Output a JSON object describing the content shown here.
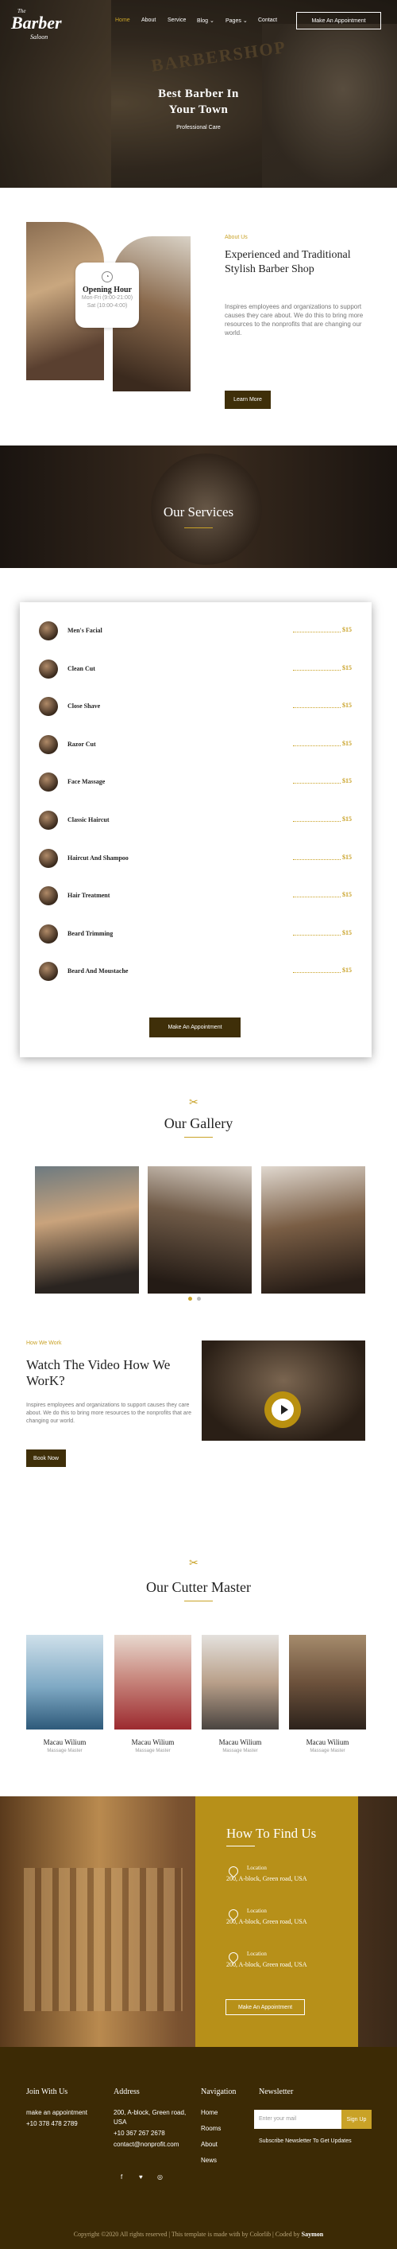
{
  "header": {
    "logo_top": "The",
    "logo_main": "Barber",
    "logo_sub": "Saloon",
    "nav": [
      "Home",
      "About",
      "Service",
      "Blog",
      "Pages",
      "Contact"
    ],
    "cta": "Make An Appointment"
  },
  "hero": {
    "sign_text": "BARBERSHOP",
    "title_line1": "Best Barber In",
    "title_line2": "Your Town",
    "subtitle": "Professional Care"
  },
  "opening": {
    "title": "Opening Hour",
    "line1": "Mon-Fri (9:00-21:00)",
    "line2": "Sat (10:00-4:00)"
  },
  "about": {
    "label": "About Us",
    "title": "Experienced and Traditional Stylish Barber Shop",
    "text": "Inspires employees and organizations to support causes they care about. We do this to bring more resources to the nonprofits that are changing our world.",
    "button": "Learn More"
  },
  "services": {
    "title": "Our Services",
    "items": [
      {
        "name": "Men's Facial",
        "price": "$15"
      },
      {
        "name": "Clean Cut",
        "price": "$15"
      },
      {
        "name": "Close Shave",
        "price": "$15"
      },
      {
        "name": "Razor Cut",
        "price": "$15"
      },
      {
        "name": "Face Massage",
        "price": "$15"
      },
      {
        "name": "Classic Haircut",
        "price": "$15"
      },
      {
        "name": "Haircut And Shampoo",
        "price": "$15"
      },
      {
        "name": "Hair Treatment",
        "price": "$15"
      },
      {
        "name": "Beard Trimming",
        "price": "$15"
      },
      {
        "name": "Beard And Moustache",
        "price": "$15"
      }
    ],
    "button": "Make An Appointment"
  },
  "gallery": {
    "title": "Our Gallery"
  },
  "video": {
    "label": "How We Work",
    "title": "Watch The Video How We WorK?",
    "text": "Inspires employees and organizations to support causes they care about. We do this to bring more resources to the nonprofits that are changing our world.",
    "button": "Book Now"
  },
  "team": {
    "title": "Our Cutter Master",
    "members": [
      {
        "name": "Macau Wilium",
        "role": "Massage Master"
      },
      {
        "name": "Macau Wilium",
        "role": "Massage Master"
      },
      {
        "name": "Macau Wilium",
        "role": "Massage Master"
      },
      {
        "name": "Macau Wilium",
        "role": "Massage Master"
      }
    ]
  },
  "find": {
    "title": "How To Find Us",
    "locations": [
      {
        "label": "Location",
        "address": "200, A-block, Green road, USA"
      },
      {
        "label": "Location",
        "address": "200, A-block, Green road, USA"
      },
      {
        "label": "Location",
        "address": "200, A-block, Green road, USA"
      }
    ],
    "button": "Make An Appointment"
  },
  "footer": {
    "join_title": "Join With Us",
    "join_line1": "make an appointment",
    "join_phone": "+10 378 478 2789",
    "address_title": "Address",
    "address_line1": "200, A-block, Green road, USA",
    "address_phone": "+10 367 267 2678",
    "address_email": "contact@nonprofit.com",
    "nav_title": "Navigation",
    "nav_items": [
      "Home",
      "Rooms",
      "About",
      "News"
    ],
    "newsletter_title": "Newsletter",
    "newsletter_placeholder": "Enter your mail",
    "newsletter_button": "Sign Up",
    "newsletter_note": "Subscribe Newsletter To Get Updates",
    "social": [
      "f",
      "♥",
      "◎"
    ],
    "copyright": "Copyright ©2020 All rights reserved | This template is made with by Colorlib | Coded by",
    "coder": "Saymon"
  },
  "colors": {
    "gold": "#c9a227",
    "dark_brown": "#3c2a05",
    "find_gold": "#b79019"
  }
}
